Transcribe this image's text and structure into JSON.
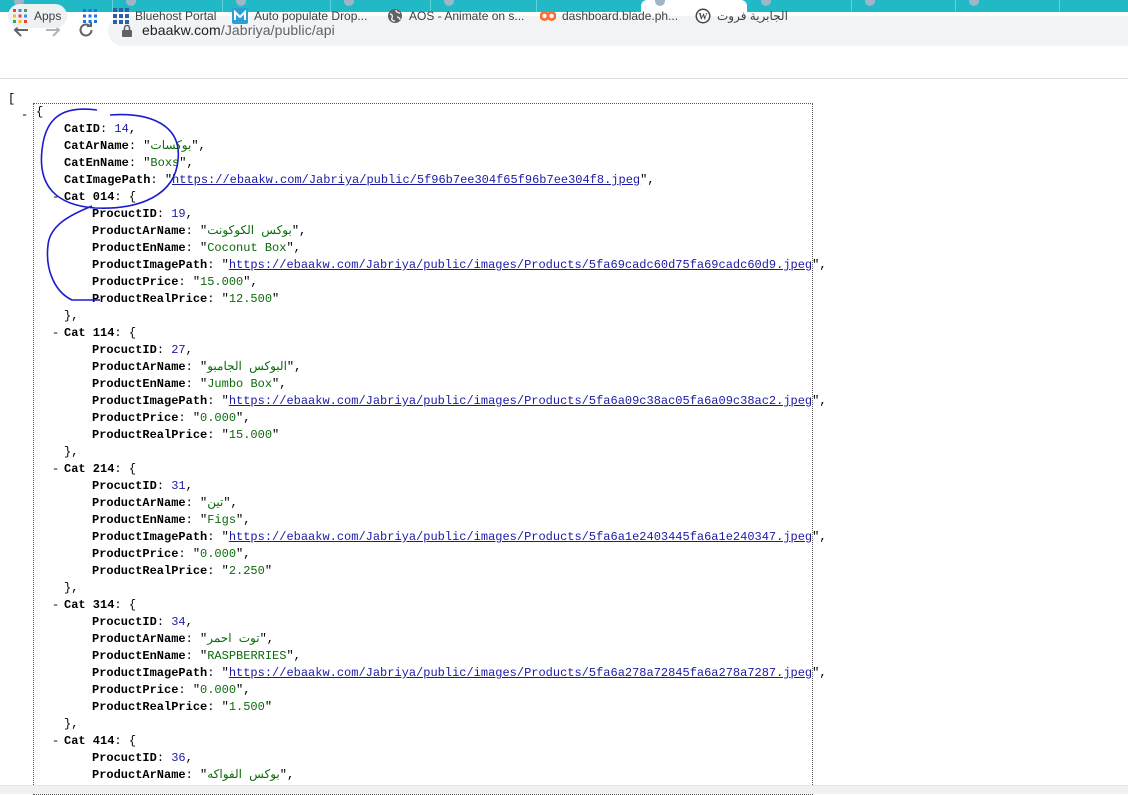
{
  "browser": {
    "url_host": "ebaakw.com",
    "url_path": "/Jabriya/public/api"
  },
  "bookmarks": [
    {
      "label": "Apps",
      "icon": "apps-grid-icon"
    },
    {
      "label": "",
      "icon": "grid-icon"
    },
    {
      "label": "Bluehost Portal",
      "icon": "bluehost-icon"
    },
    {
      "label": "Auto populate Drop...",
      "icon": "m-logo-icon"
    },
    {
      "label": "AOS - Animate on s...",
      "icon": "globe-icon"
    },
    {
      "label": "dashboard.blade.ph...",
      "icon": "cpanel-icon"
    },
    {
      "label": "الجابرية فروت",
      "icon": "wordpress-icon"
    }
  ],
  "json": {
    "open_bracket": "[",
    "open_brace": "{",
    "root": {
      "CatID": {
        "key": "CatID",
        "value": "14"
      },
      "CatArName": {
        "key": "CatArName",
        "value": "بوكسات"
      },
      "CatEnName": {
        "key": "CatEnName",
        "value": "Boxs"
      },
      "CatImagePath": {
        "key": "CatImagePath",
        "value": "https://ebaakw.com/Jabriya/public/5f96b7ee304f65f96b7ee304f8.jpeg"
      }
    },
    "products": [
      {
        "cat_key": "Cat 014",
        "id": "19",
        "ar": "بوكس الكوكونت",
        "en": "Coconut Box",
        "img": "https://ebaakw.com/Jabriya/public/images/Products/5fa69cadc60d75fa69cadc60d9.jpeg",
        "price": "15.000",
        "real": "12.500"
      },
      {
        "cat_key": "Cat 114",
        "id": "27",
        "ar": "البوكس الجامبو",
        "en": "Jumbo Box",
        "img": "https://ebaakw.com/Jabriya/public/images/Products/5fa6a09c38ac05fa6a09c38ac2.jpeg",
        "price": "0.000",
        "real": "15.000"
      },
      {
        "cat_key": "Cat 214",
        "id": "31",
        "ar": "تين",
        "en": "Figs",
        "img": "https://ebaakw.com/Jabriya/public/images/Products/5fa6a1e2403445fa6a1e240347.jpeg",
        "price": "0.000",
        "real": "2.250"
      },
      {
        "cat_key": "Cat 314",
        "id": "34",
        "ar": "توت احمر",
        "en": "RASPBERRIES",
        "img": "https://ebaakw.com/Jabriya/public/images/Products/5fa6a278a72845fa6a278a7287.jpeg",
        "price": "0.000",
        "real": "1.500"
      },
      {
        "cat_key": "Cat 414",
        "id": "36",
        "ar": "بوكس الفواكه"
      }
    ],
    "product_keys": {
      "id": "ProcuctID",
      "ar": "ProductArName",
      "en": "ProductEnName",
      "img": "ProductImagePath",
      "price": "ProductPrice",
      "real": "ProductRealPrice"
    },
    "collapse_symbol": "-",
    "annotation_color": "#1c1ccf"
  }
}
